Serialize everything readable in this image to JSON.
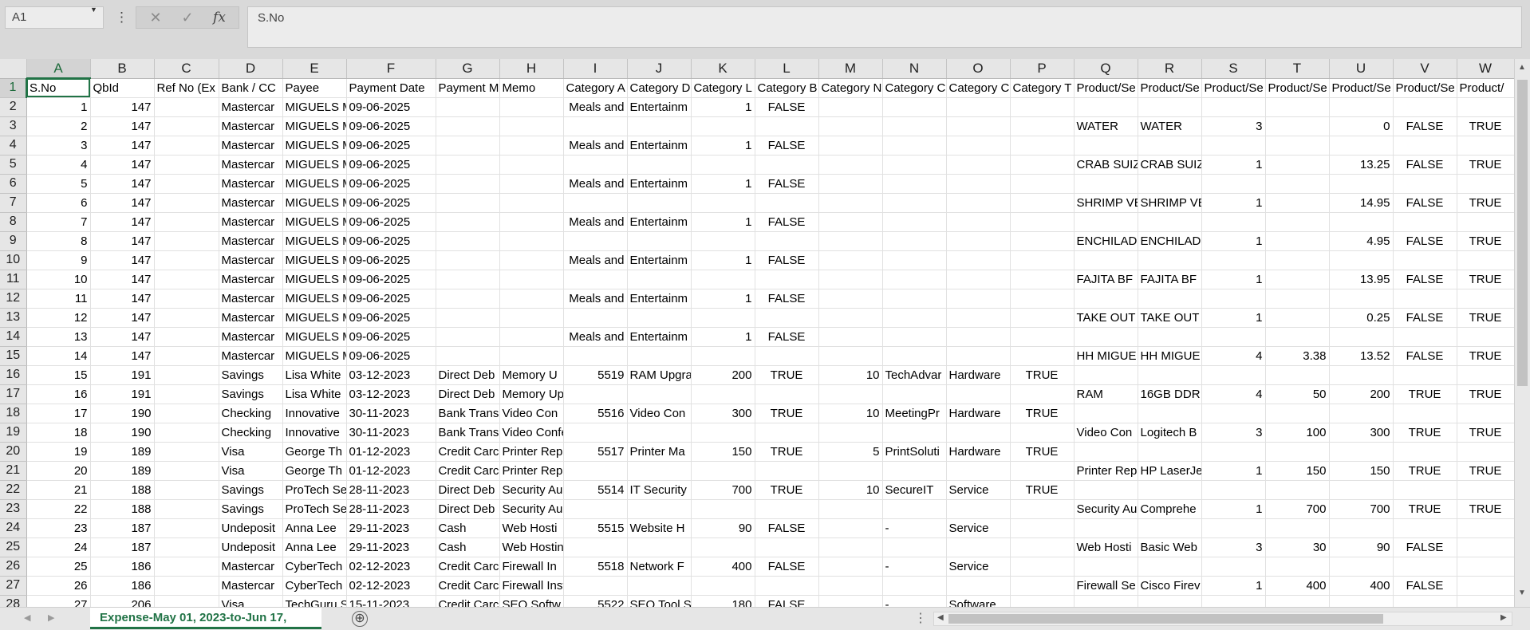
{
  "formula_bar": {
    "name_box": "A1",
    "cancel_icon": "✕",
    "enter_icon": "✓",
    "fx_label": "fx",
    "formula_value": "S.No"
  },
  "columns": [
    "A",
    "B",
    "C",
    "D",
    "E",
    "F",
    "G",
    "H",
    "I",
    "J",
    "K",
    "L",
    "M",
    "N",
    "O",
    "P",
    "Q",
    "R",
    "S",
    "T",
    "U",
    "V",
    "W"
  ],
  "cell_types": [
    "num",
    "num",
    "text",
    "text",
    "text",
    "text",
    "text",
    "text",
    "num",
    "text",
    "num",
    "bool",
    "num",
    "text",
    "text",
    "bool",
    "text",
    "text",
    "num",
    "num",
    "num",
    "bool",
    "bool"
  ],
  "rows": [
    {
      "n": "1",
      "cells": [
        "S.No",
        "QbId",
        "Ref No (Ex",
        "Bank / CC",
        "Payee",
        "Payment Date",
        "Payment M",
        "Memo",
        "Category A",
        "Category D",
        "Category L",
        "Category B",
        "Category N",
        "Category C",
        "Category C",
        "Category T",
        "Product/Se",
        "Product/Se",
        "Product/Se",
        "Product/Se",
        "Product/Se",
        "Product/Se",
        "Product/"
      ]
    },
    {
      "n": "2",
      "cells": [
        "1",
        "147",
        "",
        "Mastercar",
        "MIGUELS M",
        "09-06-2025",
        "",
        "",
        "Meals and",
        "Entertainm",
        "1",
        "FALSE",
        "",
        "",
        "",
        "",
        "",
        "",
        "",
        "",
        "",
        "",
        ""
      ]
    },
    {
      "n": "3",
      "cells": [
        "2",
        "147",
        "",
        "Mastercar",
        "MIGUELS M",
        "09-06-2025",
        "",
        "",
        "",
        "",
        "",
        "",
        "",
        "",
        "",
        "",
        "WATER",
        "WATER",
        "3",
        "",
        "0",
        "FALSE",
        "TRUE"
      ]
    },
    {
      "n": "4",
      "cells": [
        "3",
        "147",
        "",
        "Mastercar",
        "MIGUELS M",
        "09-06-2025",
        "",
        "",
        "Meals and",
        "Entertainm",
        "1",
        "FALSE",
        "",
        "",
        "",
        "",
        "",
        "",
        "",
        "",
        "",
        "",
        ""
      ]
    },
    {
      "n": "5",
      "cells": [
        "4",
        "147",
        "",
        "Mastercar",
        "MIGUELS M",
        "09-06-2025",
        "",
        "",
        "",
        "",
        "",
        "",
        "",
        "",
        "",
        "",
        "CRAB SUIZ",
        "CRAB SUIZ",
        "1",
        "",
        "13.25",
        "FALSE",
        "TRUE"
      ]
    },
    {
      "n": "6",
      "cells": [
        "5",
        "147",
        "",
        "Mastercar",
        "MIGUELS M",
        "09-06-2025",
        "",
        "",
        "Meals and",
        "Entertainm",
        "1",
        "FALSE",
        "",
        "",
        "",
        "",
        "",
        "",
        "",
        "",
        "",
        "",
        ""
      ]
    },
    {
      "n": "7",
      "cells": [
        "6",
        "147",
        "",
        "Mastercar",
        "MIGUELS M",
        "09-06-2025",
        "",
        "",
        "",
        "",
        "",
        "",
        "",
        "",
        "",
        "",
        "SHRIMP VE",
        "SHRIMP VE",
        "1",
        "",
        "14.95",
        "FALSE",
        "TRUE"
      ]
    },
    {
      "n": "8",
      "cells": [
        "7",
        "147",
        "",
        "Mastercar",
        "MIGUELS M",
        "09-06-2025",
        "",
        "",
        "Meals and",
        "Entertainm",
        "1",
        "FALSE",
        "",
        "",
        "",
        "",
        "",
        "",
        "",
        "",
        "",
        "",
        ""
      ]
    },
    {
      "n": "9",
      "cells": [
        "8",
        "147",
        "",
        "Mastercar",
        "MIGUELS M",
        "09-06-2025",
        "",
        "",
        "",
        "",
        "",
        "",
        "",
        "",
        "",
        "",
        "ENCHILAD",
        "ENCHILAD",
        "1",
        "",
        "4.95",
        "FALSE",
        "TRUE"
      ]
    },
    {
      "n": "10",
      "cells": [
        "9",
        "147",
        "",
        "Mastercar",
        "MIGUELS M",
        "09-06-2025",
        "",
        "",
        "Meals and",
        "Entertainm",
        "1",
        "FALSE",
        "",
        "",
        "",
        "",
        "",
        "",
        "",
        "",
        "",
        "",
        ""
      ]
    },
    {
      "n": "11",
      "cells": [
        "10",
        "147",
        "",
        "Mastercar",
        "MIGUELS M",
        "09-06-2025",
        "",
        "",
        "",
        "",
        "",
        "",
        "",
        "",
        "",
        "",
        "FAJITA BF",
        "FAJITA BF",
        "1",
        "",
        "13.95",
        "FALSE",
        "TRUE"
      ]
    },
    {
      "n": "12",
      "cells": [
        "11",
        "147",
        "",
        "Mastercar",
        "MIGUELS M",
        "09-06-2025",
        "",
        "",
        "Meals and",
        "Entertainm",
        "1",
        "FALSE",
        "",
        "",
        "",
        "",
        "",
        "",
        "",
        "",
        "",
        "",
        ""
      ]
    },
    {
      "n": "13",
      "cells": [
        "12",
        "147",
        "",
        "Mastercar",
        "MIGUELS M",
        "09-06-2025",
        "",
        "",
        "",
        "",
        "",
        "",
        "",
        "",
        "",
        "",
        "TAKE OUT",
        "TAKE OUT",
        "1",
        "",
        "0.25",
        "FALSE",
        "TRUE"
      ]
    },
    {
      "n": "14",
      "cells": [
        "13",
        "147",
        "",
        "Mastercar",
        "MIGUELS M",
        "09-06-2025",
        "",
        "",
        "Meals and",
        "Entertainm",
        "1",
        "FALSE",
        "",
        "",
        "",
        "",
        "",
        "",
        "",
        "",
        "",
        "",
        ""
      ]
    },
    {
      "n": "15",
      "cells": [
        "14",
        "147",
        "",
        "Mastercar",
        "MIGUELS M",
        "09-06-2025",
        "",
        "",
        "",
        "",
        "",
        "",
        "",
        "",
        "",
        "",
        "HH MIGUE",
        "HH MIGUE",
        "4",
        "3.38",
        "13.52",
        "FALSE",
        "TRUE"
      ]
    },
    {
      "n": "16",
      "cells": [
        "15",
        "191",
        "",
        "Savings",
        "Lisa White",
        "03-12-2023",
        "Direct Deb",
        "Memory U",
        "5519",
        "RAM Upgra",
        "200",
        "TRUE",
        "10",
        "TechAdvar",
        "Hardware",
        "TRUE",
        "",
        "",
        "",
        "",
        "",
        "",
        ""
      ]
    },
    {
      "n": "17",
      "cells": [
        "16",
        "191",
        "",
        "Savings",
        "Lisa White",
        "03-12-2023",
        "Direct Deb",
        "Memory Upgrade",
        "",
        "",
        "",
        "",
        "",
        "",
        "",
        "",
        "RAM",
        "16GB DDR",
        "4",
        "50",
        "200",
        "TRUE",
        "TRUE"
      ]
    },
    {
      "n": "18",
      "cells": [
        "17",
        "190",
        "",
        "Checking",
        "Innovative",
        "30-11-2023",
        "Bank Trans",
        "Video Con",
        "5516",
        "Video Con",
        "300",
        "TRUE",
        "10",
        "MeetingPr",
        "Hardware",
        "TRUE",
        "",
        "",
        "",
        "",
        "",
        "",
        ""
      ]
    },
    {
      "n": "19",
      "cells": [
        "18",
        "190",
        "",
        "Checking",
        "Innovative",
        "30-11-2023",
        "Bank Trans",
        "Video Conferencing Setup",
        "",
        "",
        "",
        "",
        "",
        "",
        "",
        "",
        "Video Con",
        "Logitech B",
        "3",
        "100",
        "300",
        "TRUE",
        "TRUE"
      ]
    },
    {
      "n": "20",
      "cells": [
        "19",
        "189",
        "",
        "Visa",
        "George Th",
        "01-12-2023",
        "Credit Carc",
        "Printer Rep",
        "5517",
        "Printer Ma",
        "150",
        "TRUE",
        "5",
        "PrintSoluti",
        "Hardware",
        "TRUE",
        "",
        "",
        "",
        "",
        "",
        "",
        ""
      ]
    },
    {
      "n": "21",
      "cells": [
        "20",
        "189",
        "",
        "Visa",
        "George Th",
        "01-12-2023",
        "Credit Carc",
        "Printer Repair",
        "",
        "",
        "",
        "",
        "",
        "",
        "",
        "",
        "Printer Rep",
        "HP LaserJe",
        "1",
        "150",
        "150",
        "TRUE",
        "TRUE"
      ]
    },
    {
      "n": "22",
      "cells": [
        "21",
        "188",
        "",
        "Savings",
        "ProTech Se",
        "28-11-2023",
        "Direct Deb",
        "Security Au",
        "5514",
        "IT Security",
        "700",
        "TRUE",
        "10",
        "SecureIT",
        "Service",
        "TRUE",
        "",
        "",
        "",
        "",
        "",
        "",
        ""
      ]
    },
    {
      "n": "23",
      "cells": [
        "22",
        "188",
        "",
        "Savings",
        "ProTech Se",
        "28-11-2023",
        "Direct Deb",
        "Security Audit",
        "",
        "",
        "",
        "",
        "",
        "",
        "",
        "",
        "Security Au",
        "Comprehe",
        "1",
        "700",
        "700",
        "TRUE",
        "TRUE"
      ]
    },
    {
      "n": "24",
      "cells": [
        "23",
        "187",
        "",
        "Undeposit",
        "Anna Lee",
        "29-11-2023",
        "Cash",
        "Web Hosti",
        "5515",
        "Website H",
        "90",
        "FALSE",
        "",
        "-",
        "Service",
        "",
        "",
        "",
        "",
        "",
        "",
        "",
        ""
      ]
    },
    {
      "n": "25",
      "cells": [
        "24",
        "187",
        "",
        "Undeposit",
        "Anna Lee",
        "29-11-2023",
        "Cash",
        "Web Hosting",
        "",
        "",
        "",
        "",
        "",
        "",
        "",
        "",
        "Web Hosti",
        "Basic Web",
        "3",
        "30",
        "90",
        "FALSE",
        ""
      ]
    },
    {
      "n": "26",
      "cells": [
        "25",
        "186",
        "",
        "Mastercar",
        "CyberTech",
        "02-12-2023",
        "Credit Carc",
        "Firewall In",
        "5518",
        "Network F",
        "400",
        "FALSE",
        "",
        "-",
        "Service",
        "",
        "",
        "",
        "",
        "",
        "",
        "",
        ""
      ]
    },
    {
      "n": "27",
      "cells": [
        "26",
        "186",
        "",
        "Mastercar",
        "CyberTech",
        "02-12-2023",
        "Credit Carc",
        "Firewall Installation",
        "",
        "",
        "",
        "",
        "",
        "",
        "",
        "",
        "Firewall Se",
        "Cisco Firev",
        "1",
        "400",
        "400",
        "FALSE",
        ""
      ]
    },
    {
      "n": "28",
      "cells": [
        "27",
        "206",
        "",
        "Visa",
        "TechGuru S",
        "15-11-2023",
        "Credit Carc",
        "SEO Softw",
        "5522",
        "SEO Tool S",
        "180",
        "FALSE",
        "",
        "-",
        "Software",
        "",
        "",
        "",
        "",
        "",
        "",
        "",
        ""
      ]
    }
  ],
  "sheet_tab": {
    "label": "Expense-May 01, 2023-to-Jun 17,",
    "add_icon": "⊕"
  }
}
